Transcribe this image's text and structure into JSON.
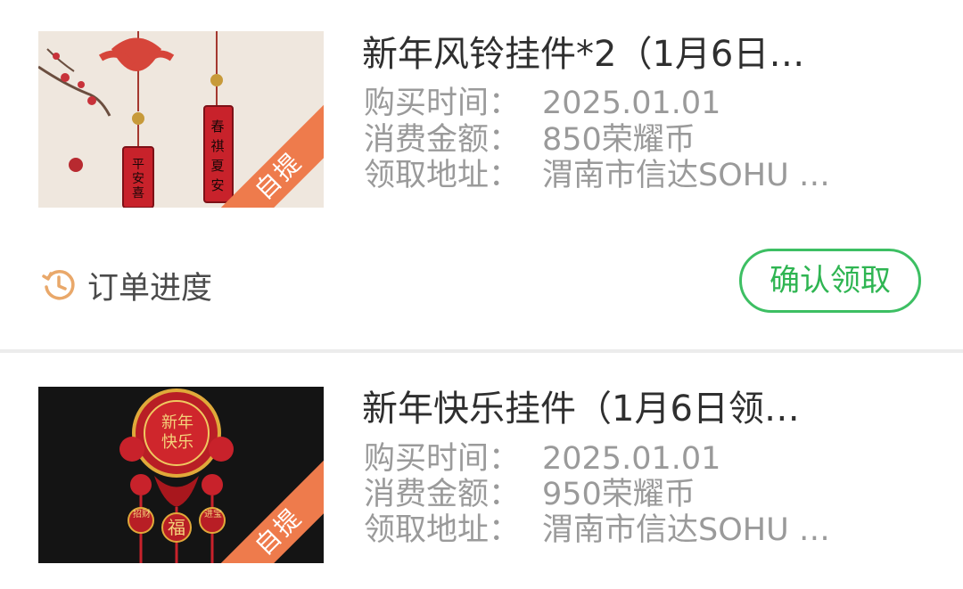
{
  "orders": [
    {
      "title": "新年风铃挂件*2（1月6日…",
      "badge": "自提",
      "purchase_label": "购买时间：",
      "purchase_time": "2025.01.01",
      "cost_label": "消费金额：",
      "cost": "850荣耀币",
      "address_label": "领取地址：",
      "address": "渭南市信达SOHU …",
      "progress_label": "订单进度",
      "progress_icon": "clock-history-icon",
      "confirm_label": "确认领取",
      "image_desc_icon": "wind-chime-image"
    },
    {
      "title": "新年快乐挂件（1月6日领…",
      "badge": "自提",
      "purchase_label": "购买时间：",
      "purchase_time": "2025.01.01",
      "cost_label": "消费金额：",
      "cost": "950荣耀币",
      "address_label": "领取地址：",
      "address": "渭南市信达SOHU …",
      "image_desc_icon": "new-year-ornament-image"
    }
  ],
  "product_art": {
    "chime_left_text": "平安喜",
    "chime_right_text": "春祺夏安",
    "ornament_center_text": "新年快乐",
    "ornament_left_text": "招财",
    "ornament_mid_text": "福",
    "ornament_right_text": "进宝"
  },
  "colors": {
    "accent_green": "#3dbf63",
    "badge_orange": "#ee7b4c",
    "progress_icon": "#e9a86a"
  }
}
